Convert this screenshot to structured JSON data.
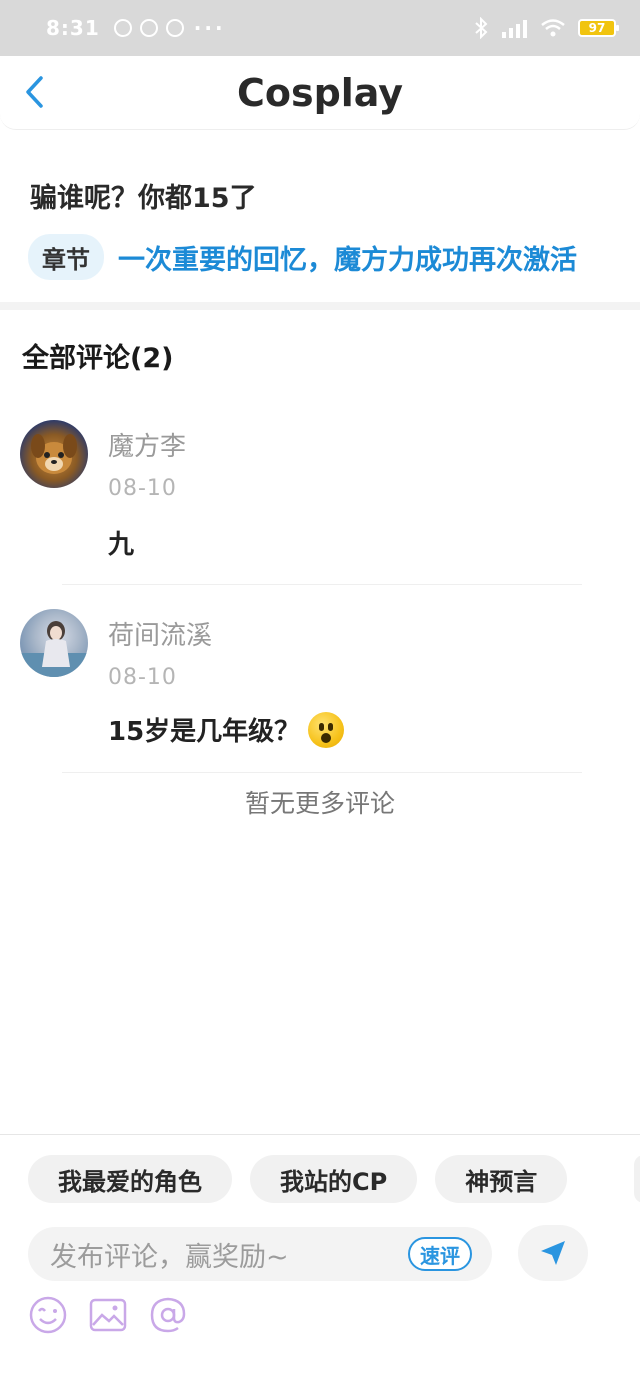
{
  "status_bar": {
    "time": "8:31",
    "more": "···",
    "battery": "97"
  },
  "nav": {
    "back_icon": "chevron-left-icon",
    "title": "Cosplay"
  },
  "post": {
    "text": "骗谁呢？你都15了",
    "chapter_tag": "章节",
    "chapter_link": "一次重要的回忆，魔方力成功再次激活"
  },
  "comments_section": {
    "header": "全部评论(2)",
    "items": [
      {
        "name": "魔方李",
        "date": "08-10",
        "text": "九"
      },
      {
        "name": "荷间流溪",
        "date": "08-10",
        "text": "15岁是几年级？",
        "emoji": "astonished-face"
      }
    ],
    "no_more": "暂无更多评论"
  },
  "bottom_bar": {
    "chips": [
      "我最爱的角色",
      "我站的CP",
      "神预言"
    ],
    "input_placeholder": "发布评论，赢奖励~",
    "quick_rate": "速评",
    "icons": [
      "smiley-icon",
      "image-icon",
      "at-icon",
      "send-icon"
    ]
  },
  "colors": {
    "accent": "#1c8ad6",
    "icon_purple": "#c9a8e8"
  }
}
